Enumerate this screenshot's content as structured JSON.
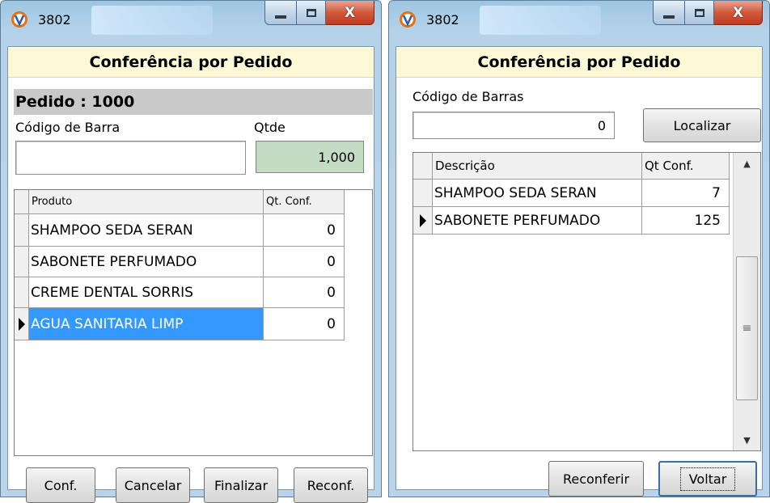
{
  "left_window": {
    "title": "3802",
    "form_title": "Conferência por Pedido",
    "pedido_label": "Pedido : 1000",
    "barcode_label": "Código de Barra",
    "barcode_value": "",
    "qty_label": "Qtde",
    "qty_value": "1,000",
    "grid": {
      "columns": [
        "Produto",
        "Qt. Conf."
      ],
      "rows": [
        {
          "produto": "SHAMPOO SEDA SERAN",
          "qt": "0"
        },
        {
          "produto": "SABONETE PERFUMADO",
          "qt": "0"
        },
        {
          "produto": "CREME DENTAL SORRIS",
          "qt": "0"
        },
        {
          "produto": "AGUA SANITARIA LIMP",
          "qt": "0"
        }
      ]
    },
    "buttons": {
      "conf": "Conf.",
      "cancelar": "Cancelar",
      "finalizar": "Finalizar",
      "reconf": "Reconf."
    }
  },
  "right_window": {
    "title": "3802",
    "form_title": "Conferência por Pedido",
    "barcode_label": "Código de Barras",
    "barcode_value": "0",
    "localizar": "Localizar",
    "grid": {
      "columns": [
        "Descrição",
        "Qt Conf."
      ],
      "rows": [
        {
          "descricao": "SHAMPOO SEDA SERAN",
          "qt": "7"
        },
        {
          "descricao": "SABONETE PERFUMADO",
          "qt": "125"
        }
      ]
    },
    "buttons": {
      "reconferir": "Reconferir",
      "voltar": "Voltar"
    }
  },
  "icons": {
    "app": "app-logo-icon",
    "minimize": "minimize-icon",
    "maximize": "maximize-icon",
    "close": "close-icon",
    "row_indicator": "row-pointer-icon",
    "scroll_up": "scroll-up-icon",
    "scroll_down": "scroll-down-icon"
  },
  "colors": {
    "header_bg": "#fdf8d6",
    "selection": "#3399ff",
    "qty_field": "#c5dcc4"
  }
}
